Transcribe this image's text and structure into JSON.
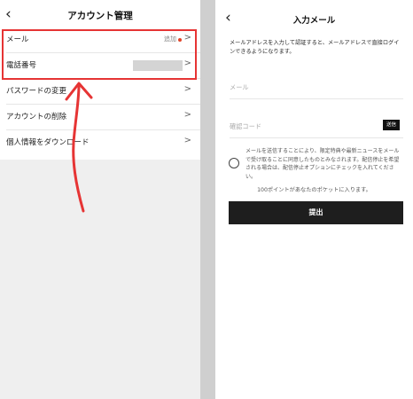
{
  "account": {
    "back_icon": "back-chevron-icon",
    "title": "アカウント管理",
    "rows": [
      {
        "label": "メール",
        "action": "追加"
      },
      {
        "label": "電話番号"
      },
      {
        "label": "パスワードの変更"
      },
      {
        "label": "アカウントの削除"
      },
      {
        "label": "個人情報をダウンロード"
      }
    ]
  },
  "email_form": {
    "back_icon": "back-chevron-icon",
    "title": "入力メール",
    "description": "メールアドレスを入力して認証すると、メールアドレスで直接ログインできるようになります。",
    "email_placeholder": "メール",
    "code_placeholder": "確認コード",
    "send_label": "送信",
    "consent": "メールを送信することにより、限定特典や最新ニュースをメールで受け取ることに同意したものとみなされます。配信停止を希望される場合は、配信停止オプションにチェックを入れてください。",
    "points": "100ポイントがあなたのポケットに入ります。",
    "submit_label": "提出"
  },
  "colors": {
    "highlight": "#e63434",
    "notification_dot": "#e0452a",
    "button_bg": "#1e1e1e"
  }
}
